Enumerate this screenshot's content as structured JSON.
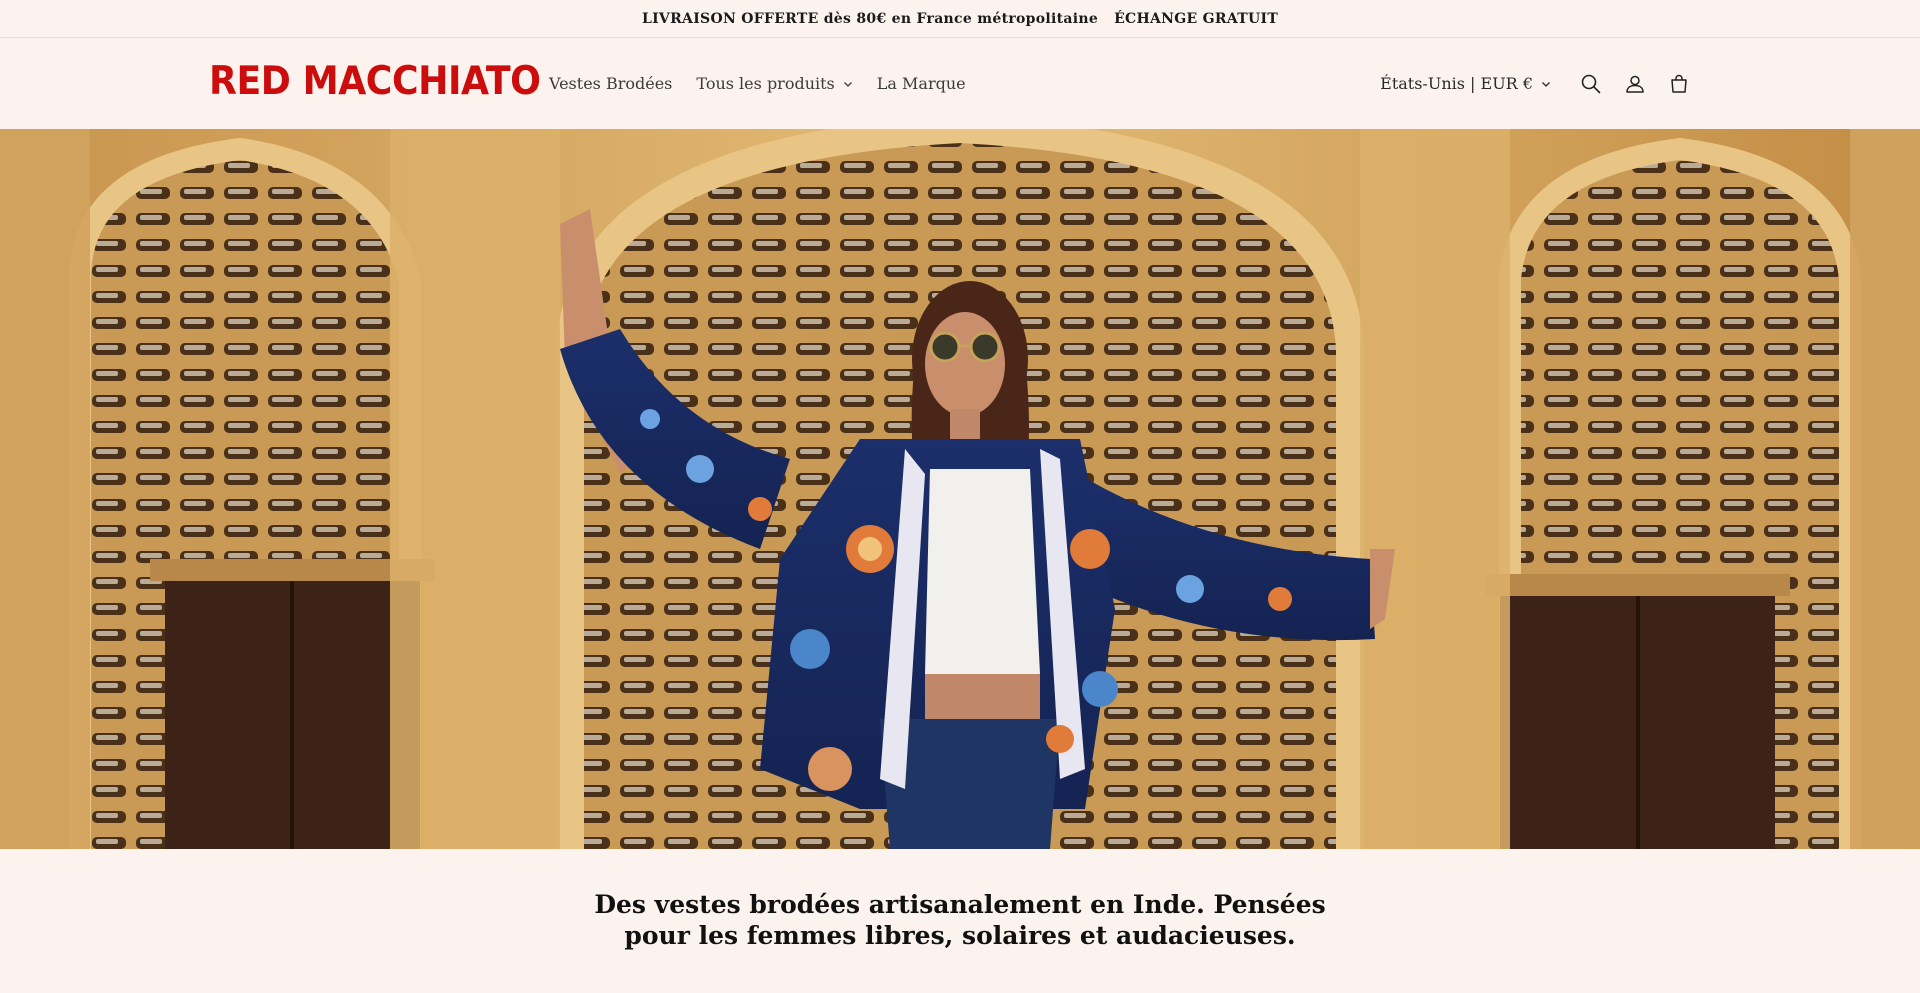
{
  "announcement": {
    "shipping": "LIVRAISON OFFERTE dès 80€ en France métropolitaine",
    "exchange": "ÉCHANGE GRATUIT"
  },
  "header": {
    "logo": "RED MACCHIATO",
    "nav": [
      {
        "label": "Vestes Brodées"
      },
      {
        "label": "Tous les produits"
      },
      {
        "label": "La Marque"
      }
    ],
    "locale": "États-Unis | EUR €",
    "icons": [
      "search-icon",
      "account-icon",
      "cart-icon"
    ]
  },
  "hero": {
    "description_icon": "hero-image"
  },
  "tagline": {
    "text": "Des vestes brodées artisanalement en Inde. Pensées pour les femmes libres, solaires et audacieuses."
  },
  "colors": {
    "background": "#fcf3ee",
    "brand_red": "#cc0d0d",
    "text": "#1a1a1a"
  }
}
